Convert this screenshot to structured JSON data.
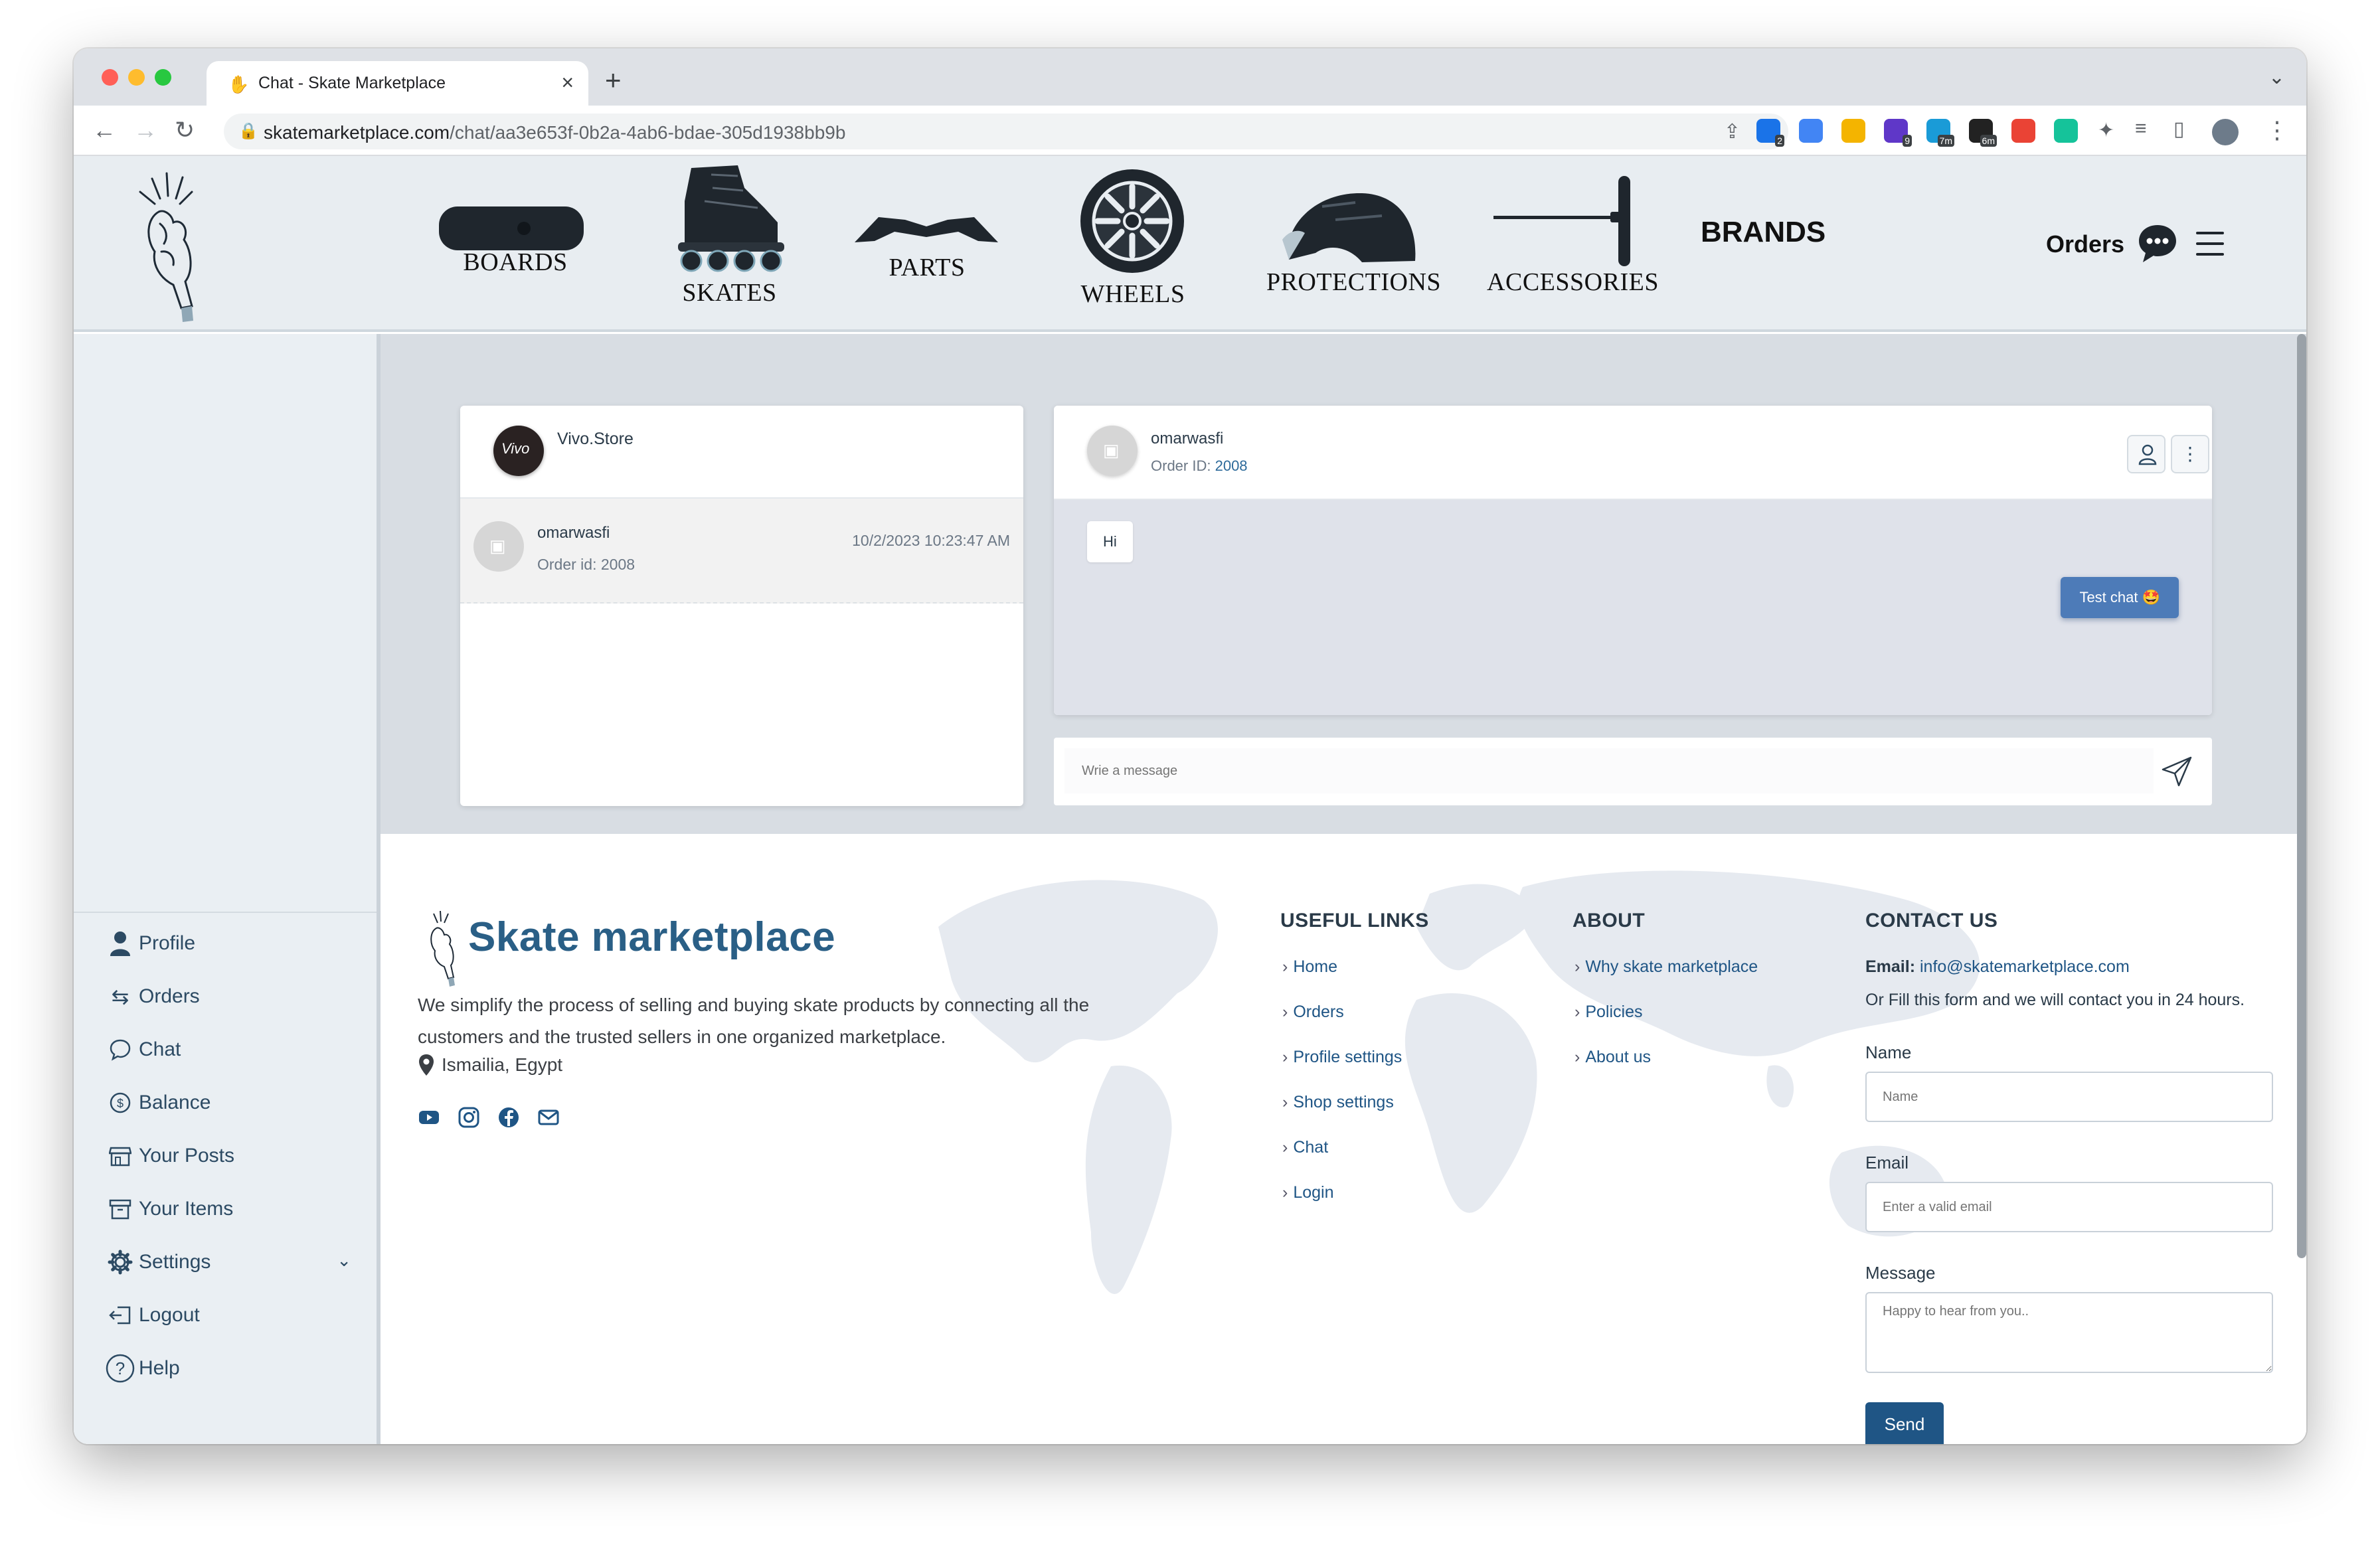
{
  "browser": {
    "tab_title": "Chat - Skate Marketplace",
    "url_domain": "skatemarketplace.com",
    "url_path": "/chat/aa3e653f-0b2a-4ab6-bdae-305d1938bb9b",
    "extensions": [
      {
        "name": "extension-icon-1",
        "badge": "2",
        "color": "#1a73e8"
      },
      {
        "name": "translate-icon",
        "badge": "",
        "color": "#4285f4"
      },
      {
        "name": "analytics-icon",
        "badge": "",
        "color": "#f4b400"
      },
      {
        "name": "extension-icon-4",
        "badge": "9",
        "color": "#5f37c8"
      },
      {
        "name": "extension-icon-5",
        "badge": "7m",
        "color": "#1a9bd7"
      },
      {
        "name": "extension-icon-6",
        "badge": "6m",
        "color": "#222"
      },
      {
        "name": "gmail-icon",
        "badge": "",
        "color": "#ea4335"
      },
      {
        "name": "grammar-icon",
        "badge": "",
        "color": "#15c39a"
      }
    ]
  },
  "header": {
    "categories": [
      "BOARDS",
      "SKATES",
      "PARTS",
      "WHEELS",
      "PROTECTIONS",
      "ACCESSORIES"
    ],
    "brands": "BRANDS",
    "orders": "Orders"
  },
  "sidebar": {
    "items": [
      {
        "label": "Profile",
        "icon": "person-icon"
      },
      {
        "label": "Orders",
        "icon": "arrows-icon"
      },
      {
        "label": "Chat",
        "icon": "chat-bubble-icon"
      },
      {
        "label": "Balance",
        "icon": "dollar-coin-icon"
      },
      {
        "label": "Your Posts",
        "icon": "shop-icon"
      },
      {
        "label": "Your Items",
        "icon": "box-icon"
      },
      {
        "label": "Settings",
        "icon": "gear-icon"
      },
      {
        "label": "Logout",
        "icon": "logout-icon"
      },
      {
        "label": "Help",
        "icon": "help-icon"
      }
    ]
  },
  "chat": {
    "store_name": "Vivo.Store",
    "store_avatar_text": "Vivo",
    "conversations": [
      {
        "user": "omarwasfi",
        "subtitle": "Order id: 2008",
        "time": "10/2/2023 10:23:47 AM"
      }
    ],
    "active": {
      "user": "omarwasfi",
      "order_label": "Order ID:",
      "order_id": "2008"
    },
    "messages": [
      {
        "text": "Hi",
        "side": "left"
      },
      {
        "text": "Test chat 🤩",
        "side": "right"
      }
    ],
    "input_placeholder": "Wrie a message",
    "colors": {
      "bubble_right": "#4d7bb8",
      "thread_bg": "#dfe2ea"
    }
  },
  "footer": {
    "brand": "Skate marketplace",
    "description": "We simplify the process of selling and buying skate products by connecting all the customers and the trusted sellers in one organized marketplace.",
    "location": "Ismailia, Egypt",
    "useful_links_title": "USEFUL LINKS",
    "useful_links": [
      "Home",
      "Orders",
      "Profile settings",
      "Shop settings",
      "Chat",
      "Login"
    ],
    "about_title": "ABOUT",
    "about_links": [
      "Why skate marketplace",
      "Policies",
      "About us"
    ],
    "contact_title": "CONTACT US",
    "email_label": "Email:",
    "email": "info@skatemarketplace.com",
    "contact_note": "Or Fill this form and we will contact you in 24 hours.",
    "name_label": "Name",
    "name_placeholder": "Name",
    "email_field_label": "Email",
    "email_placeholder": "Enter a valid email",
    "message_label": "Message",
    "message_placeholder": "Happy to hear from you..",
    "send": "Send",
    "brand_color": "#2a5f86"
  }
}
